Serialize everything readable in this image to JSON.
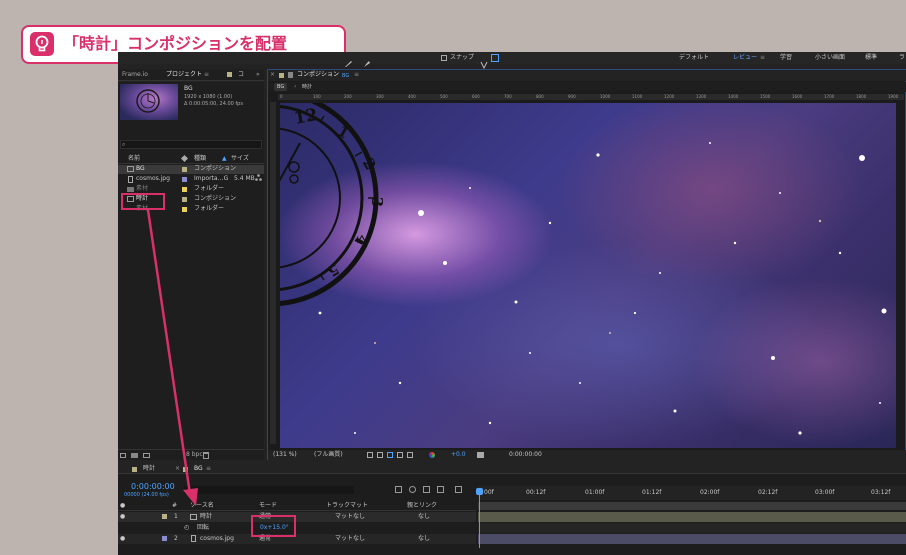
{
  "callout": {
    "text": "「時計」コンポジションを配置",
    "accent": "#d9306b"
  },
  "toolbar": {
    "snap_label": "スナップ",
    "workspaces": [
      "デフォルト",
      "レビュー",
      "学習",
      "小さい画面",
      "標準",
      "ラ"
    ],
    "active_workspace": "レビュー"
  },
  "left_top": {
    "file_label": "Frame.io",
    "project_tab": "プロジェクト",
    "menu_glyph": "≡",
    "extra_tab": "コ"
  },
  "project": {
    "selected_name": "BG",
    "info_lines": [
      "1920 x 1080 (1.00)",
      "Δ 0:00:05:00, 24.00 fps"
    ],
    "search_icon_glyph": "⌕",
    "columns": {
      "name": "名前",
      "type": "種類",
      "size": "サイズ"
    },
    "items": [
      {
        "name": "BG",
        "type": "コンポジション",
        "size": "",
        "kind": "comp",
        "color": "#b9b286"
      },
      {
        "name": "cosmos.jpg",
        "type": "Importa…G",
        "size": "5.4 MB",
        "kind": "file",
        "color": "#8c8cd0"
      },
      {
        "name": "素材",
        "type": "フォルダー",
        "size": "",
        "kind": "folder",
        "color": "#e8d25a"
      },
      {
        "name": "時計",
        "type": "コンポジション",
        "size": "",
        "kind": "comp",
        "color": "#b9b286"
      },
      {
        "name": "素材",
        "type": "フォルダー",
        "size": "",
        "kind": "folder",
        "color": "#e8d25a"
      }
    ]
  },
  "comp": {
    "tab_label": "コンポジション",
    "tab_name": "BG",
    "breadcrumbs": [
      "BG",
      "時計"
    ],
    "ruler_ticks": [
      "0",
      "100",
      "200",
      "300",
      "400",
      "500",
      "600",
      "700",
      "800",
      "900",
      "1000",
      "1100",
      "1200",
      "1300",
      "1400",
      "1500",
      "1600",
      "1700",
      "1800",
      "1900"
    ],
    "zoom": "(131 %)",
    "resolution": "(フル画質)",
    "exposure": "+0.0",
    "time": "0:00:00:00",
    "clock_numbers": [
      "12",
      "1",
      "2",
      "3",
      "4",
      "5"
    ],
    "bpc": "8 bpc"
  },
  "timeline": {
    "tabs": [
      "時計",
      "BG"
    ],
    "active_tab": "BG",
    "timecode": "0:00:00:00",
    "frame_info": "00000 (24.00 fps)",
    "headers": {
      "source": "ソース名",
      "mode": "モード",
      "trackmatte": "トラックマット",
      "parent": "親とリンク",
      "hash": "#"
    },
    "layers": [
      {
        "num": "1",
        "name": "時計",
        "mode": "通常",
        "matte": "マットなし",
        "parent": "なし",
        "color": "#b9b286"
      },
      {
        "num": "2",
        "name": "cosmos.jpg",
        "mode": "通常",
        "matte": "マットなし",
        "parent": "なし",
        "color": "#8c8cd0"
      }
    ],
    "property": {
      "name": "回転",
      "value": "0x+15.0°"
    },
    "time_ticks": [
      "00f",
      "00:12f",
      "01:00f",
      "01:12f",
      "02:00f",
      "02:12f",
      "03:00f",
      "03:12f"
    ]
  }
}
